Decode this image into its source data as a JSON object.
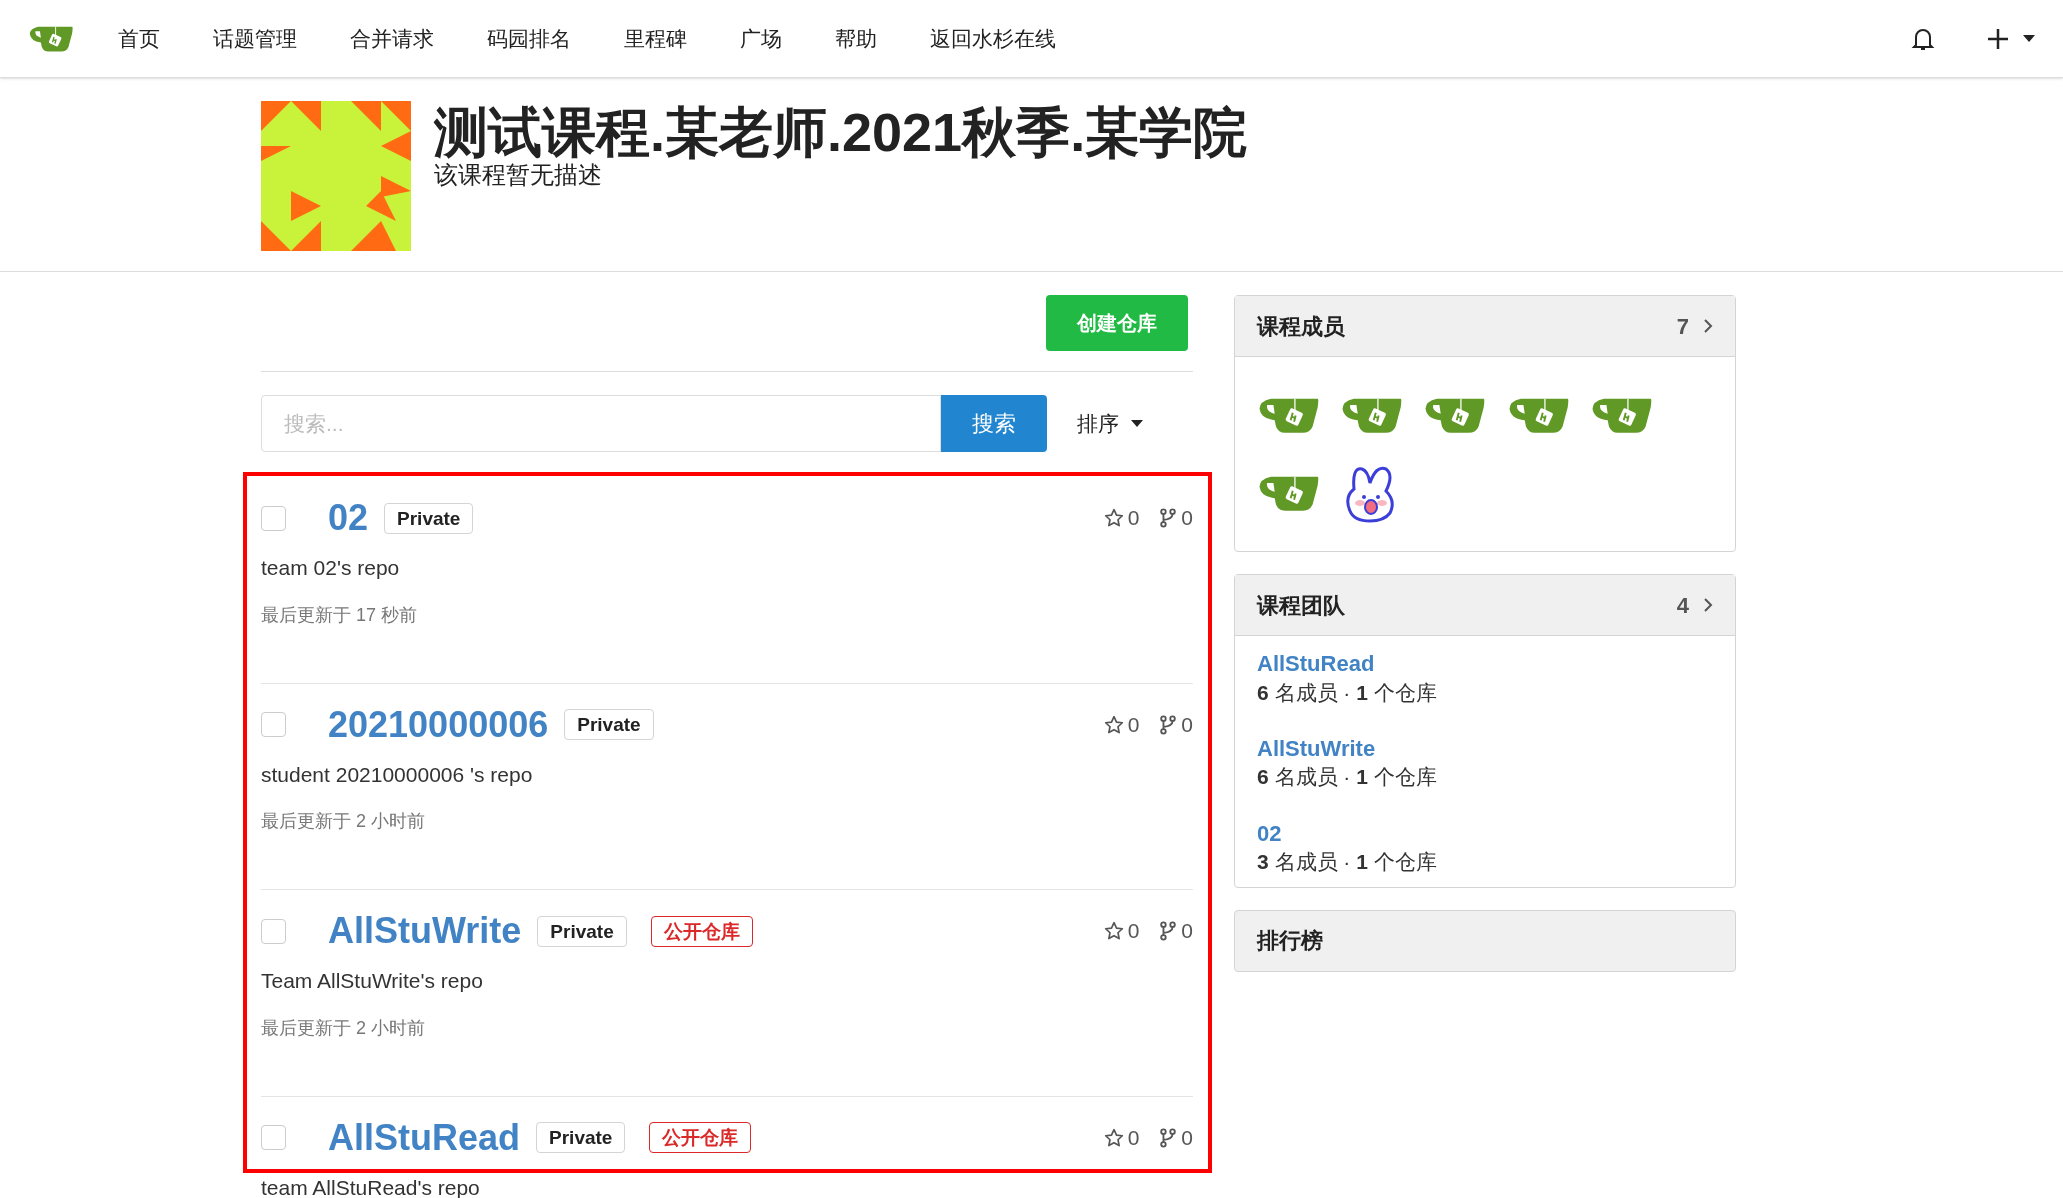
{
  "nav": {
    "items": [
      "首页",
      "话题管理",
      "合并请求",
      "码园排名",
      "里程碑",
      "广场",
      "帮助",
      "返回水杉在线"
    ]
  },
  "header": {
    "title": "测试课程.某老师.2021秋季.某学院",
    "description": "该课程暂无描述"
  },
  "create_button": "创建仓库",
  "search": {
    "placeholder": "搜索...",
    "button": "搜索",
    "sort": "排序"
  },
  "repos": [
    {
      "name": "02",
      "checked": false,
      "tags": [
        {
          "kind": "private",
          "label": "Private"
        }
      ],
      "stars": "0",
      "forks": "0",
      "description": "team 02's repo",
      "updated": "最后更新于 17 秒前"
    },
    {
      "name": "20210000006",
      "checked": false,
      "tags": [
        {
          "kind": "private",
          "label": "Private"
        }
      ],
      "stars": "0",
      "forks": "0",
      "description": "student 20210000006 's repo",
      "updated": "最后更新于 2 小时前"
    },
    {
      "name": "AllStuWrite",
      "checked": false,
      "tags": [
        {
          "kind": "private",
          "label": "Private"
        },
        {
          "kind": "public",
          "label": "公开仓库"
        }
      ],
      "stars": "0",
      "forks": "0",
      "description": "Team AllStuWrite's repo",
      "updated": "最后更新于 2 小时前"
    },
    {
      "name": "AllStuRead",
      "checked": false,
      "tags": [
        {
          "kind": "private",
          "label": "Private"
        },
        {
          "kind": "public",
          "label": "公开仓库"
        }
      ],
      "stars": "0",
      "forks": "0",
      "description": "team AllStuRead's repo"
    }
  ],
  "members": {
    "title": "课程成员",
    "count": "7",
    "avatars": [
      {
        "kind": "cup"
      },
      {
        "kind": "cup"
      },
      {
        "kind": "cup"
      },
      {
        "kind": "cup"
      },
      {
        "kind": "cup"
      },
      {
        "kind": "cup"
      },
      {
        "kind": "bunny"
      }
    ]
  },
  "teams": {
    "title": "课程团队",
    "count": "4",
    "items": [
      {
        "name": "AllStuRead",
        "stats": "**6** 名成员 · **1** 个仓库"
      },
      {
        "name": "AllStuWrite",
        "stats": "**6** 名成员 · **1** 个仓库"
      },
      {
        "name": "02",
        "stats": "**3** 名成员 · **1** 个仓库"
      }
    ]
  },
  "ranking": {
    "title": "排行榜"
  }
}
